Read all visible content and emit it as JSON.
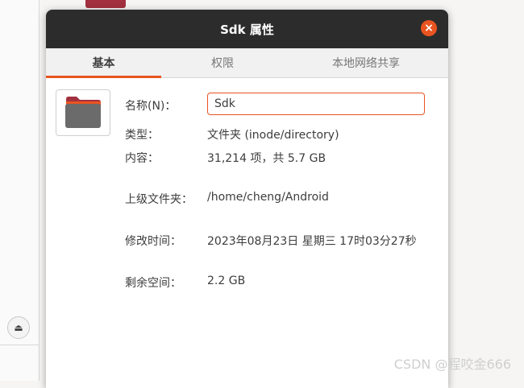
{
  "dialog": {
    "title": "Sdk 属性",
    "close_icon": "×"
  },
  "tabs": [
    {
      "label": "基本",
      "active": true
    },
    {
      "label": "权限",
      "active": false
    },
    {
      "label": "本地网络共享",
      "active": false
    }
  ],
  "fields": {
    "name_label": "名称(N)：",
    "name_value": "Sdk",
    "type_label": "类型：",
    "type_value": "文件夹 (inode/directory)",
    "contents_label": "内容：",
    "contents_value": "31,214 项，共 5.7 GB",
    "parent_label": "上级文件夹：",
    "parent_value": "/home/cheng/Android",
    "modified_label": "修改时间：",
    "modified_value": "2023年08月23日 星期三 17时03分27秒",
    "free_label": "剩余空间：",
    "free_value": "2.2 GB"
  },
  "background": {
    "eject_icon": "⏏"
  },
  "watermark": "CSDN @程咬金666",
  "colors": {
    "accent": "#e95420",
    "titlebar": "#2c2c2c",
    "folder": "#6b6b6b",
    "folder_tab": "#a3303f"
  }
}
